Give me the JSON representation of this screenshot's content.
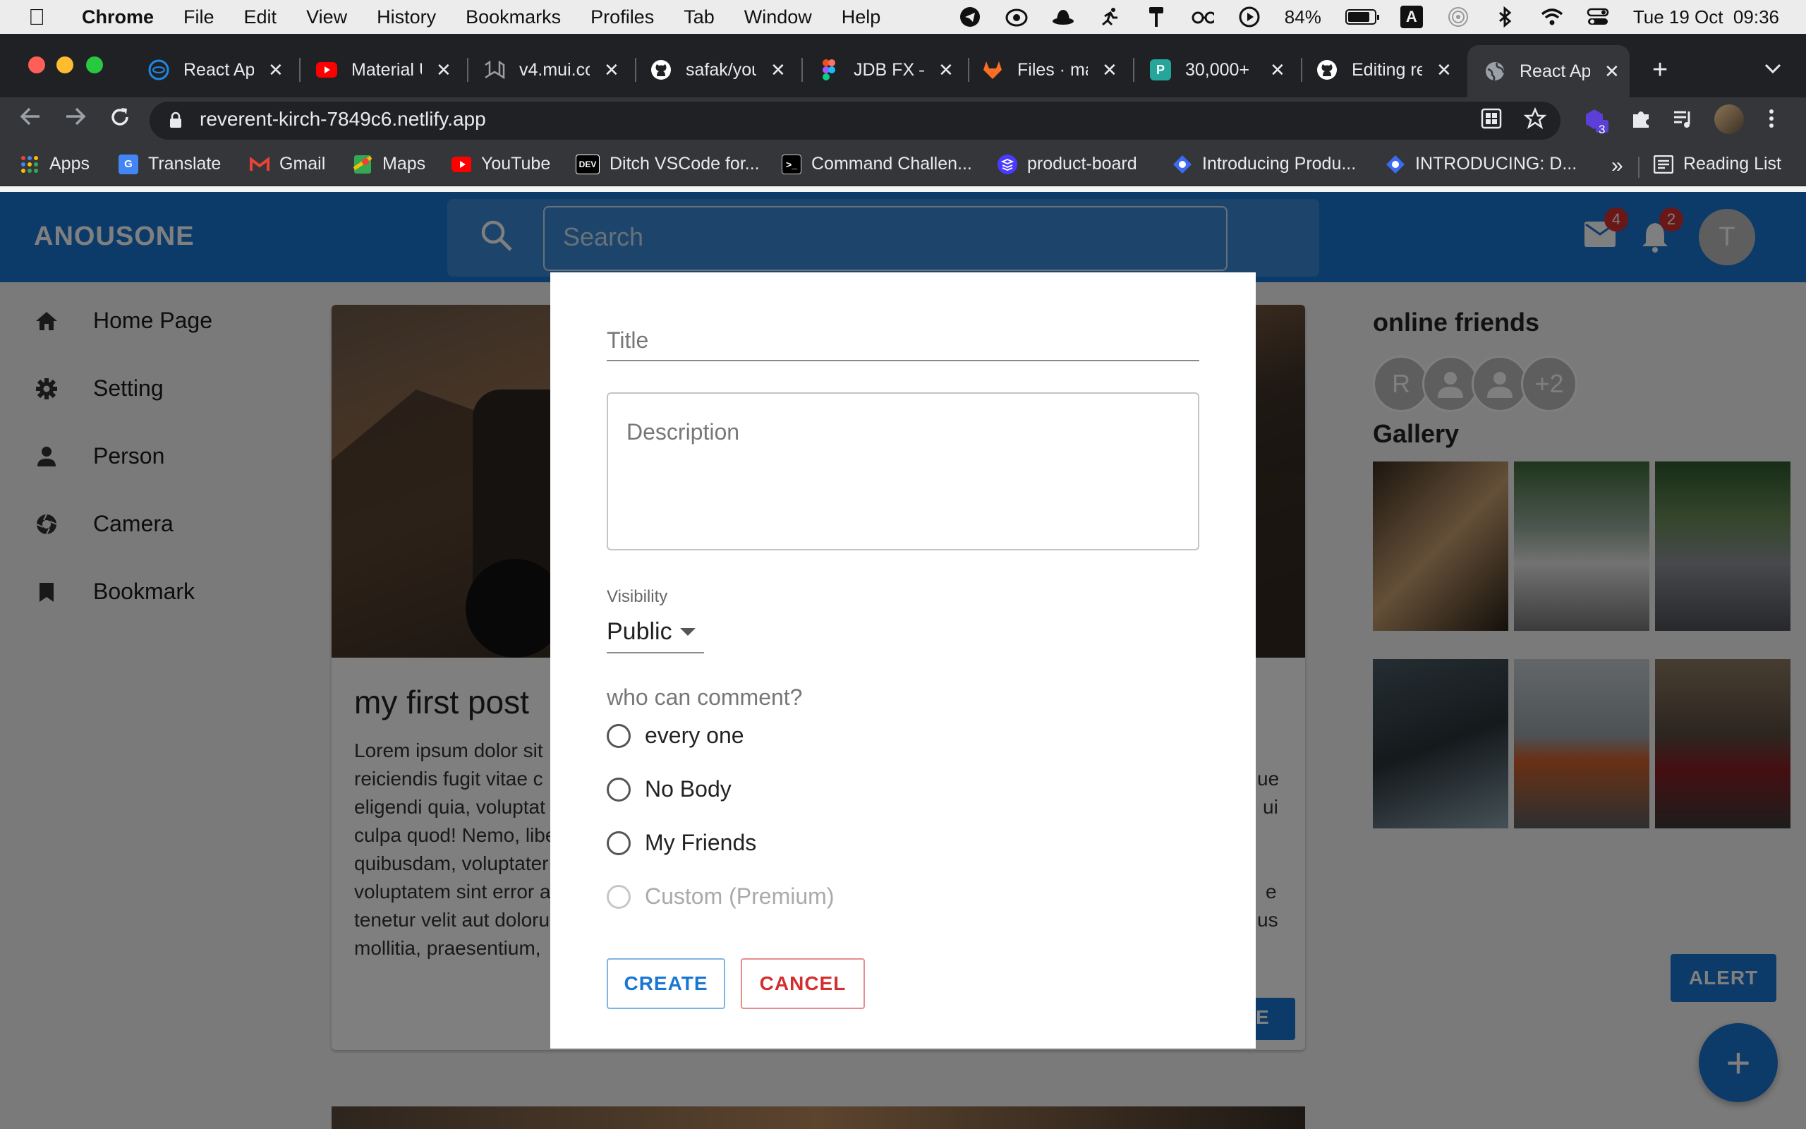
{
  "menubar": {
    "app": "Chrome",
    "items": [
      "File",
      "Edit",
      "View",
      "History",
      "Bookmarks",
      "Profiles",
      "Tab",
      "Window",
      "Help"
    ],
    "battery": "84%",
    "input_source": "A",
    "datetime": "Tue 19 Oct  09:36"
  },
  "tabs": [
    {
      "title": "React App",
      "icon": "react-icon",
      "color": "#1e88e5"
    },
    {
      "title": "Material U",
      "icon": "youtube-icon",
      "color": "#ff0000"
    },
    {
      "title": "v4.mui.co",
      "icon": "mui-icon",
      "color": "#9e9e9e"
    },
    {
      "title": "safak/you",
      "icon": "github-icon",
      "color": "#ffffff"
    },
    {
      "title": "JDB FX –",
      "icon": "figma-icon",
      "color": "#a259ff"
    },
    {
      "title": "Files · ma",
      "icon": "gitlab-icon",
      "color": "#fc6d26"
    },
    {
      "title": "30,000+",
      "icon": "p-icon",
      "color": "#26a69a"
    },
    {
      "title": "Editing re",
      "icon": "github-icon",
      "color": "#ffffff"
    },
    {
      "title": "React App",
      "icon": "globe-icon",
      "color": "#9aa0a6"
    }
  ],
  "address": {
    "url": "reverent-kirch-7849c6.netlify.app"
  },
  "extensions": {
    "badge": "3"
  },
  "bookmarks": [
    {
      "label": "Apps",
      "icon": "apps-grid-icon",
      "color": "#4285f4"
    },
    {
      "label": "Translate",
      "icon": "translate-icon",
      "color": "#4285f4"
    },
    {
      "label": "Gmail",
      "icon": "gmail-icon",
      "color": "#ea4335"
    },
    {
      "label": "Maps",
      "icon": "maps-icon",
      "color": "#34a853"
    },
    {
      "label": "YouTube",
      "icon": "youtube-icon",
      "color": "#ff0000"
    },
    {
      "label": "Ditch VSCode for...",
      "icon": "dev-icon",
      "color": "#000000"
    },
    {
      "label": "Command Challen...",
      "icon": "terminal-icon",
      "color": "#000000"
    },
    {
      "label": "product-board",
      "icon": "productboard-icon",
      "color": "#4a3aff"
    },
    {
      "label": "Introducing Produ...",
      "icon": "diamond-icon",
      "color": "#3d6af2"
    },
    {
      "label": "INTRODUCING: D...",
      "icon": "diamond-icon",
      "color": "#3d6af2"
    }
  ],
  "bookmarks_more": "»",
  "reading_list": "Reading List",
  "app": {
    "brand": "ANOUSONE",
    "search_placeholder": "Search",
    "mail_count": "4",
    "notif_count": "2",
    "avatar_letter": "T",
    "primary_color": "#1976d2"
  },
  "sidebar": [
    {
      "label": "Home Page",
      "icon": "home-icon"
    },
    {
      "label": "Setting",
      "icon": "gear-icon"
    },
    {
      "label": "Person",
      "icon": "person-icon"
    },
    {
      "label": "Camera",
      "icon": "camera-icon"
    },
    {
      "label": "Bookmark",
      "icon": "bookmark-icon"
    }
  ],
  "post": {
    "title": "my first post",
    "left_lines": [
      "Lorem ipsum dolor sit",
      "reiciendis fugit vitae c",
      "eligendi quia, voluptat",
      "culpa quod! Nemo, libe",
      "quibusdam, voluptater",
      "voluptatem sint error a",
      "tenetur velit aut doloru",
      "mollitia, praesentium,"
    ],
    "right_fragments": [
      "ue",
      "ui",
      "e",
      "us"
    ],
    "button_fragment": "E"
  },
  "right_panel": {
    "online_title": "online friends",
    "friend_initial": "R",
    "more_friends": "+2",
    "gallery_title": "Gallery",
    "alert_label": "ALERT",
    "fab_label": "+"
  },
  "modal": {
    "title_placeholder": "Title",
    "description_placeholder": "Description",
    "visibility_label": "Visibility",
    "visibility_value": "Public",
    "comment_question": "who can comment?",
    "options": [
      {
        "label": "every one",
        "disabled": false
      },
      {
        "label": "No Body",
        "disabled": false
      },
      {
        "label": "My Friends",
        "disabled": false
      },
      {
        "label": "Custom (Premium)",
        "disabled": true
      }
    ],
    "create_label": "CREATE",
    "cancel_label": "CANCEL",
    "create_color": "#1976d2",
    "cancel_color": "#d32f2f"
  }
}
